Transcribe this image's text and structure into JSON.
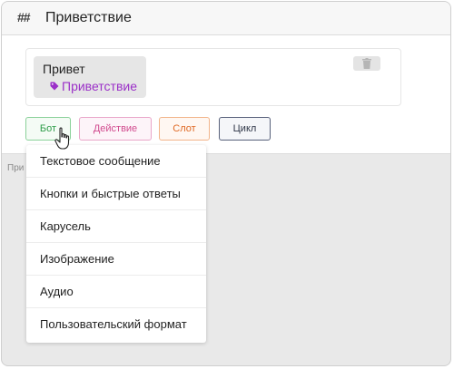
{
  "header": {
    "title": "Приветствие",
    "icon": "hash-icon"
  },
  "card": {
    "message": "Привет",
    "intent": "Приветствие",
    "intent_color": "#9b30c8"
  },
  "chips": {
    "bot": "Бот",
    "action": "Действие",
    "slot": "Слот",
    "loop": "Цикл"
  },
  "hint_text": "При",
  "dropdown": {
    "items": [
      "Текстовое сообщение",
      "Кнопки и быстрые ответы",
      "Карусель",
      "Изображение",
      "Аудио",
      "Пользовательский формат"
    ]
  }
}
